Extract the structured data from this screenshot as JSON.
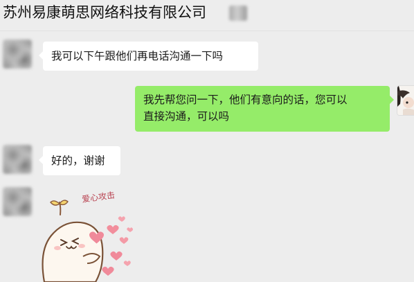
{
  "header": {
    "title": "苏州易康萌思网络科技有限公司"
  },
  "messages": [
    {
      "side": "left",
      "text": "我可以下午跟他们再电话沟通一下吗"
    },
    {
      "side": "right",
      "lines": [
        "我先帮您问一下，他们有意向的话，您可以",
        "直接沟通，可以吗"
      ]
    },
    {
      "side": "left",
      "text": "好的，谢谢"
    }
  ],
  "sticker": {
    "caption": "爱心攻击",
    "icon": "heart-sticker"
  },
  "colors": {
    "background": "#ededed",
    "bubble_self": "#95ec69",
    "bubble_other": "#ffffff",
    "heart": "#f08a9a"
  }
}
